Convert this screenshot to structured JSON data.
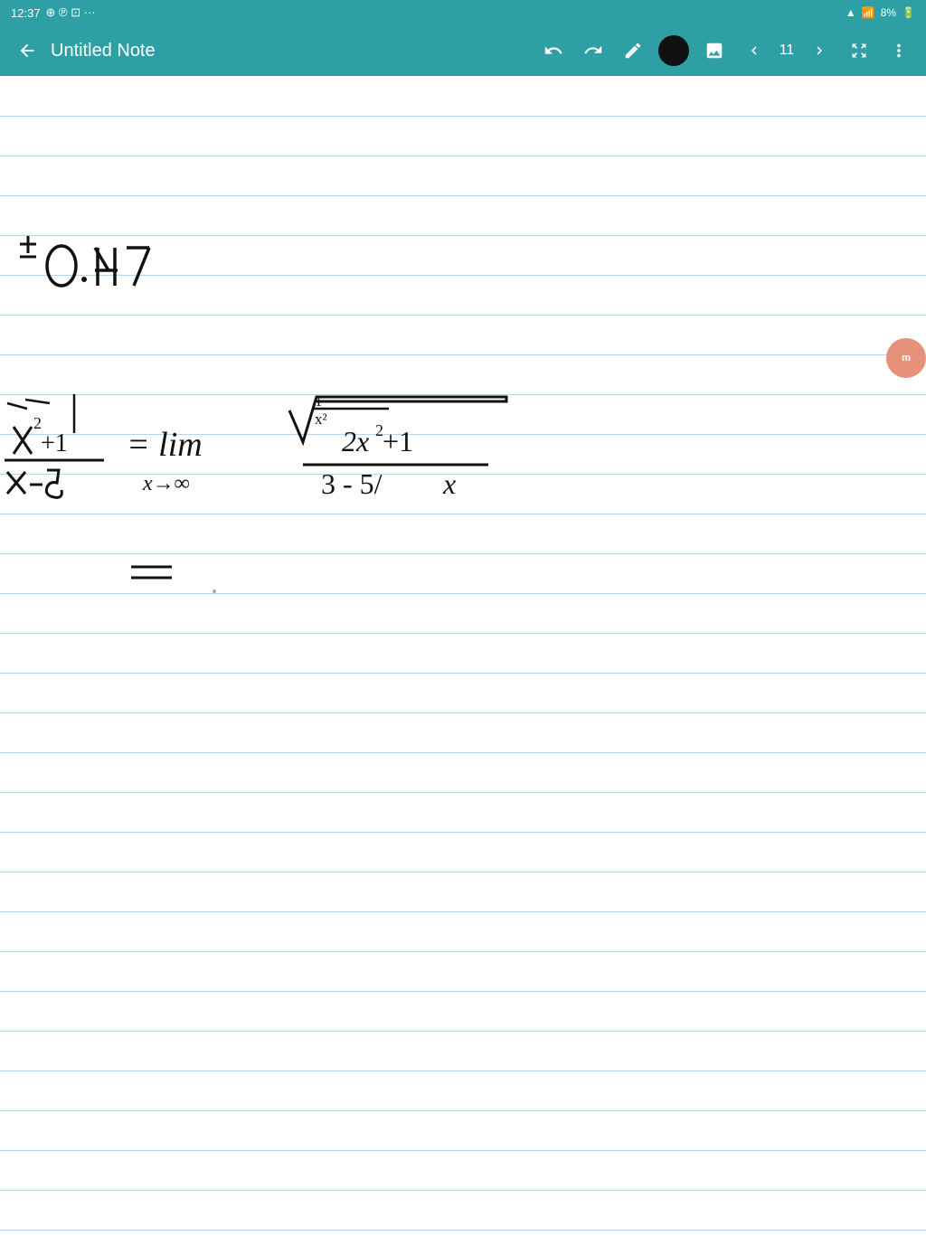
{
  "statusBar": {
    "time": "12:37",
    "battery": "8%",
    "signal": "●"
  },
  "toolbar": {
    "title": "Untitled Note",
    "undoLabel": "↩",
    "redoLabel": "↪",
    "penLabel": "✏",
    "colorLabel": "●",
    "imageLabel": "🖼",
    "prevLabel": "<",
    "pageNum": "11",
    "nextLabel": ">",
    "moreLabel": "⋮",
    "backLabel": "←"
  },
  "avatar": {
    "initials": "m"
  }
}
